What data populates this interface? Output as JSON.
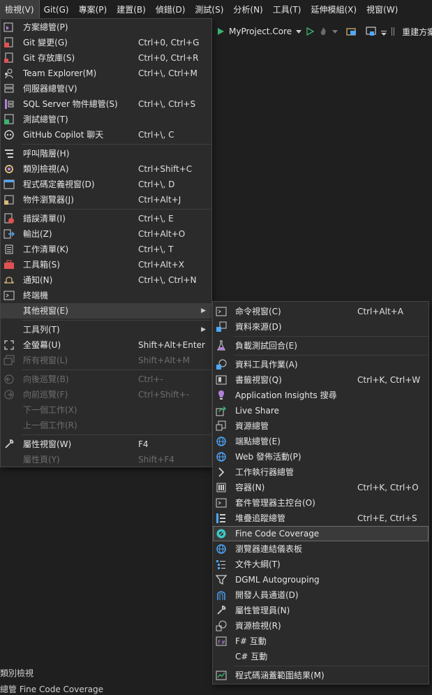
{
  "menubar": {
    "items": [
      "檢視(V)",
      "Git(G)",
      "專案(P)",
      "建置(B)",
      "偵錯(D)",
      "測試(S)",
      "分析(N)",
      "工具(T)",
      "延伸模組(X)",
      "視窗(W)"
    ]
  },
  "toolbar": {
    "project": "MyProject.Core",
    "rebuild_label": "重建方案"
  },
  "main_menu": {
    "groups": [
      [
        {
          "label": "方案總管(P)",
          "shortcut": "",
          "icon": "solution-explorer-icon"
        },
        {
          "label": "Git 變更(G)",
          "shortcut": "Ctrl+0, Ctrl+G",
          "icon": "git-changes-icon"
        },
        {
          "label": "Git 存放庫(S)",
          "shortcut": "Ctrl+0, Ctrl+R",
          "icon": "git-repository-icon"
        },
        {
          "label": "Team Explorer(M)",
          "shortcut": "Ctrl+\\, Ctrl+M",
          "icon": "team-explorer-icon"
        },
        {
          "label": "伺服器總管(V)",
          "shortcut": "",
          "icon": "server-explorer-icon"
        },
        {
          "label": "SQL Server 物件總管(S)",
          "shortcut": "Ctrl+\\, Ctrl+S",
          "icon": "sql-server-icon"
        },
        {
          "label": "測試總管(T)",
          "shortcut": "",
          "icon": "test-explorer-icon"
        },
        {
          "label": "GitHub Copilot 聊天",
          "shortcut": "Ctrl+\\, C",
          "icon": "copilot-icon"
        }
      ],
      [
        {
          "label": "呼叫階層(H)",
          "shortcut": "",
          "icon": "call-hierarchy-icon"
        },
        {
          "label": "類別檢視(A)",
          "shortcut": "Ctrl+Shift+C",
          "icon": "class-view-icon"
        },
        {
          "label": "程式碼定義視窗(D)",
          "shortcut": "Ctrl+\\, D",
          "icon": "code-definition-icon"
        },
        {
          "label": "物件瀏覽器(J)",
          "shortcut": "Ctrl+Alt+J",
          "icon": "object-browser-icon"
        }
      ],
      [
        {
          "label": "錯誤清單(I)",
          "shortcut": "Ctrl+\\, E",
          "icon": "error-list-icon"
        },
        {
          "label": "輸出(Z)",
          "shortcut": "Ctrl+Alt+O",
          "icon": "output-icon"
        },
        {
          "label": "工作清單(K)",
          "shortcut": "Ctrl+\\, T",
          "icon": "task-list-icon"
        },
        {
          "label": "工具箱(S)",
          "shortcut": "Ctrl+Alt+X",
          "icon": "toolbox-icon"
        },
        {
          "label": "通知(N)",
          "shortcut": "Ctrl+\\, Ctrl+N",
          "icon": "notification-bell-icon"
        },
        {
          "label": "終端機",
          "shortcut": "",
          "icon": "terminal-icon"
        },
        {
          "label": "其他視窗(E)",
          "shortcut": "",
          "icon": "",
          "submenu": true,
          "highlighted": true
        }
      ],
      [
        {
          "label": "工具列(T)",
          "shortcut": "",
          "icon": "",
          "submenu": true
        },
        {
          "label": "全螢幕(U)",
          "shortcut": "Shift+Alt+Enter",
          "icon": "full-screen-icon"
        },
        {
          "label": "所有視窗(L)",
          "shortcut": "Shift+Alt+M",
          "icon": "all-windows-icon",
          "disabled": true
        }
      ],
      [
        {
          "label": "向後巡覽(B)",
          "shortcut": "Ctrl+-",
          "icon": "navigate-back-icon",
          "disabled": true
        },
        {
          "label": "向前巡覽(F)",
          "shortcut": "Ctrl+Shift+-",
          "icon": "navigate-forward-icon",
          "disabled": true
        },
        {
          "label": "下一個工作(X)",
          "shortcut": "",
          "icon": "",
          "disabled": true
        },
        {
          "label": "上一個工作(R)",
          "shortcut": "",
          "icon": "",
          "disabled": true
        }
      ],
      [
        {
          "label": "屬性視窗(W)",
          "shortcut": "F4",
          "icon": "properties-wrench-icon"
        },
        {
          "label": "屬性頁(Y)",
          "shortcut": "Shift+F4",
          "icon": "",
          "disabled": true
        }
      ]
    ]
  },
  "sub_menu": {
    "groups": [
      [
        {
          "label": "命令視窗(C)",
          "shortcut": "Ctrl+Alt+A",
          "icon": "command-window-icon"
        },
        {
          "label": "資料來源(D)",
          "shortcut": "",
          "icon": "data-sources-icon"
        }
      ],
      [
        {
          "label": "負載測試回合(E)",
          "shortcut": "",
          "icon": "load-test-icon"
        }
      ],
      [
        {
          "label": "資料工具作業(A)",
          "shortcut": "",
          "icon": "data-tools-icon"
        },
        {
          "label": "書籤視窗(Q)",
          "shortcut": "Ctrl+K, Ctrl+W",
          "icon": "bookmark-window-icon"
        },
        {
          "label": "Application Insights 搜尋",
          "shortcut": "",
          "icon": "app-insights-icon"
        },
        {
          "label": "Live Share",
          "shortcut": "",
          "icon": "live-share-icon"
        },
        {
          "label": "資源總管",
          "shortcut": "",
          "icon": "resource-explorer-icon"
        },
        {
          "label": "端點總管(E)",
          "shortcut": "",
          "icon": "endpoint-globe-icon"
        },
        {
          "label": "Web 發佈活動(P)",
          "shortcut": "",
          "icon": "web-publish-icon"
        },
        {
          "label": "工作執行器總管",
          "shortcut": "",
          "icon": "task-runner-chevron-icon"
        },
        {
          "label": "容器(N)",
          "shortcut": "Ctrl+K, Ctrl+O",
          "icon": "containers-icon"
        },
        {
          "label": "套件管理器主控台(O)",
          "shortcut": "",
          "icon": "package-console-icon"
        },
        {
          "label": "堆疊追蹤總管",
          "shortcut": "Ctrl+E, Ctrl+S",
          "icon": "stack-trace-icon"
        },
        {
          "label": "Fine Code Coverage",
          "shortcut": "",
          "icon": "fine-code-coverage-icon",
          "selected": true
        },
        {
          "label": "瀏覽器連結儀表板",
          "shortcut": "",
          "icon": "browser-link-globe-icon"
        },
        {
          "label": "文件大綱(T)",
          "shortcut": "",
          "icon": "document-outline-icon"
        },
        {
          "label": "DGML Autogrouping",
          "shortcut": "",
          "icon": "dgml-filter-icon"
        },
        {
          "label": "開發人員通道(D)",
          "shortcut": "",
          "icon": "dev-tunnel-icon"
        },
        {
          "label": "屬性管理員(N)",
          "shortcut": "",
          "icon": "property-manager-wrench-icon"
        },
        {
          "label": "資源檢視(R)",
          "shortcut": "",
          "icon": "resource-view-icon"
        },
        {
          "label": "F# 互動",
          "shortcut": "",
          "icon": "fsharp-interactive-icon"
        },
        {
          "label": "C# 互動",
          "shortcut": "",
          "icon": ""
        }
      ],
      [
        {
          "label": "程式碼涵蓋範圍結果(M)",
          "shortcut": "",
          "icon": "code-coverage-results-icon"
        }
      ]
    ]
  },
  "background": {
    "class_view_tab": "類別檢視",
    "status_partial": "總管  Fine Code Coverage"
  },
  "colors": {
    "menu_bg": "#2b2b2b",
    "highlight": "#3d3d3d",
    "accent_green": "#3cb371",
    "accent_blue": "#4fa8ff",
    "accent_red": "#e05252",
    "accent_purple": "#b180d7"
  }
}
